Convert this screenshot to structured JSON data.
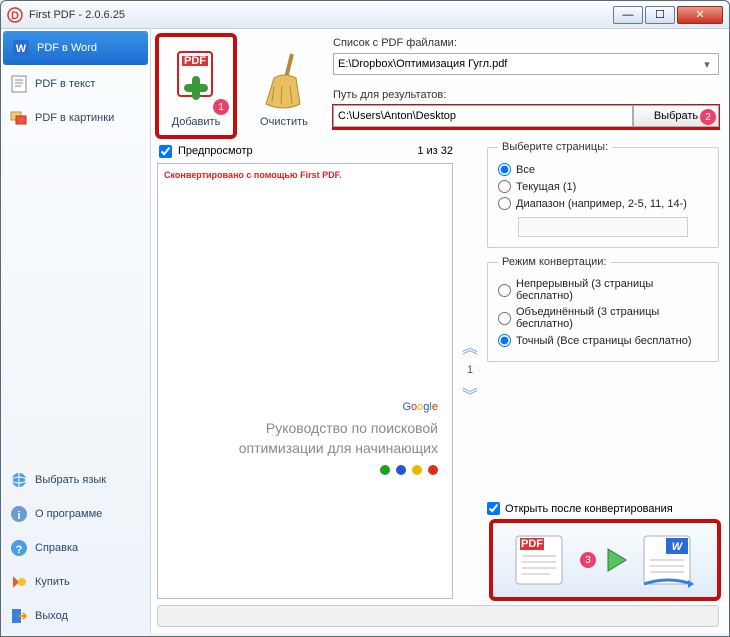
{
  "window": {
    "title": "First PDF - 2.0.6.25"
  },
  "win_buttons": {
    "min": "—",
    "max": "☐",
    "close": "✕"
  },
  "sidebar": {
    "items": [
      {
        "label": "PDF в Word"
      },
      {
        "label": "PDF в текст"
      },
      {
        "label": "PDF в картинки"
      }
    ],
    "bottom": [
      {
        "label": "Выбрать язык"
      },
      {
        "label": "О программе"
      },
      {
        "label": "Справка"
      },
      {
        "label": "Купить"
      },
      {
        "label": "Выход"
      }
    ]
  },
  "toolbar": {
    "add_label": "Добавить",
    "clear_label": "Очистить"
  },
  "paths": {
    "list_label": "Список с PDF файлами:",
    "list_value": "E:\\Dropbox\\Оптимизация Гугл.pdf",
    "result_label": "Путь для результатов:",
    "result_value": "C:\\Users\\Anton\\Desktop",
    "browse_label": "Выбрать"
  },
  "preview": {
    "checkbox_label": "Предпросмотр",
    "page_counter": "1 из 32",
    "watermark": "Сконвертировано с помощью First PDF.",
    "doc_line1": "Руководство по поисковой",
    "doc_line2": "оптимизации для начинающих",
    "google": {
      "g1": "G",
      "o1": "o",
      "o2": "o",
      "g2": "g",
      "l": "l",
      "e": "e"
    },
    "current_page": "1"
  },
  "options": {
    "pages_legend": "Выберите страницы:",
    "all": "Все",
    "current": "Текущая (1)",
    "range": "Диапазон (например, 2-5, 11, 14-)",
    "mode_legend": "Режим конвертации:",
    "continuous": "Непрерывный (3 страницы бесплатно)",
    "merged": "Объединённый (3 страницы бесплатно)",
    "exact": "Точный (Все страницы бесплатно)"
  },
  "footer": {
    "open_after": "Открыть после конвертирования"
  },
  "badges": {
    "b1": "1",
    "b2": "2",
    "b3": "3"
  }
}
